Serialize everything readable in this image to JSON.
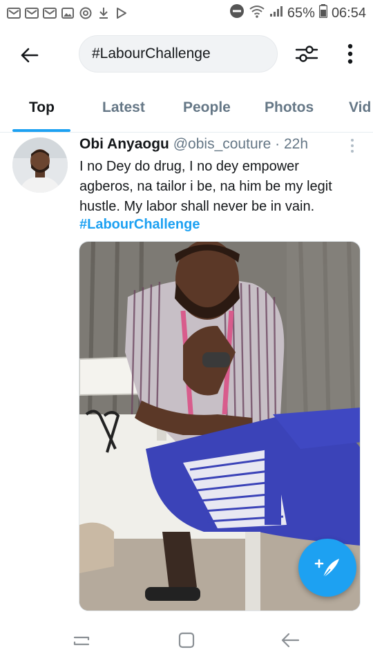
{
  "status_bar": {
    "battery": "65%",
    "time": "06:54"
  },
  "search": {
    "query": "#LabourChallenge"
  },
  "tabs": [
    {
      "label": "Top",
      "active": true
    },
    {
      "label": "Latest",
      "active": false
    },
    {
      "label": "People",
      "active": false
    },
    {
      "label": "Photos",
      "active": false
    },
    {
      "label": "Vid",
      "active": false
    }
  ],
  "tweet": {
    "name": "Obi Anyaogu",
    "handle": "@obis_couture",
    "separator": "·",
    "time": "22h",
    "text": "I no Dey do drug, I no dey empower agberos, na tailor i be, na him be my legit hustle. My labor shall never be in vain.",
    "hashtag": "#LabourChallenge"
  },
  "colors": {
    "accent": "#1da1f2",
    "text_primary": "#14171a",
    "text_secondary": "#657786"
  }
}
